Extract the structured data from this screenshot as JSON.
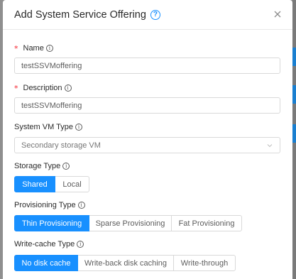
{
  "modal": {
    "title": "Add System Service Offering"
  },
  "fields": {
    "name": {
      "label": "Name",
      "value": "testSSVMoffering"
    },
    "description": {
      "label": "Description",
      "value": "testSSVMoffering"
    },
    "system_vm_type": {
      "label": "System VM Type",
      "selected": "Secondary storage VM"
    },
    "storage_type": {
      "label": "Storage Type",
      "options": [
        "Shared",
        "Local"
      ],
      "selected": "Shared"
    },
    "provisioning_type": {
      "label": "Provisioning Type",
      "options": [
        "Thin Provisioning",
        "Sparse Provisioning",
        "Fat Provisioning"
      ],
      "selected": "Thin Provisioning"
    },
    "write_cache_type": {
      "label": "Write-cache Type",
      "options": [
        "No disk cache",
        "Write-back disk caching",
        "Write-through"
      ],
      "selected": "No disk cache"
    }
  },
  "icons": {
    "help": "question-circle-icon",
    "close": "close-icon",
    "info": "info-circle-icon",
    "dropdown": "chevron-down-icon"
  },
  "colors": {
    "primary": "#1890ff",
    "required": "#f5222d",
    "border": "#d9d9d9"
  }
}
